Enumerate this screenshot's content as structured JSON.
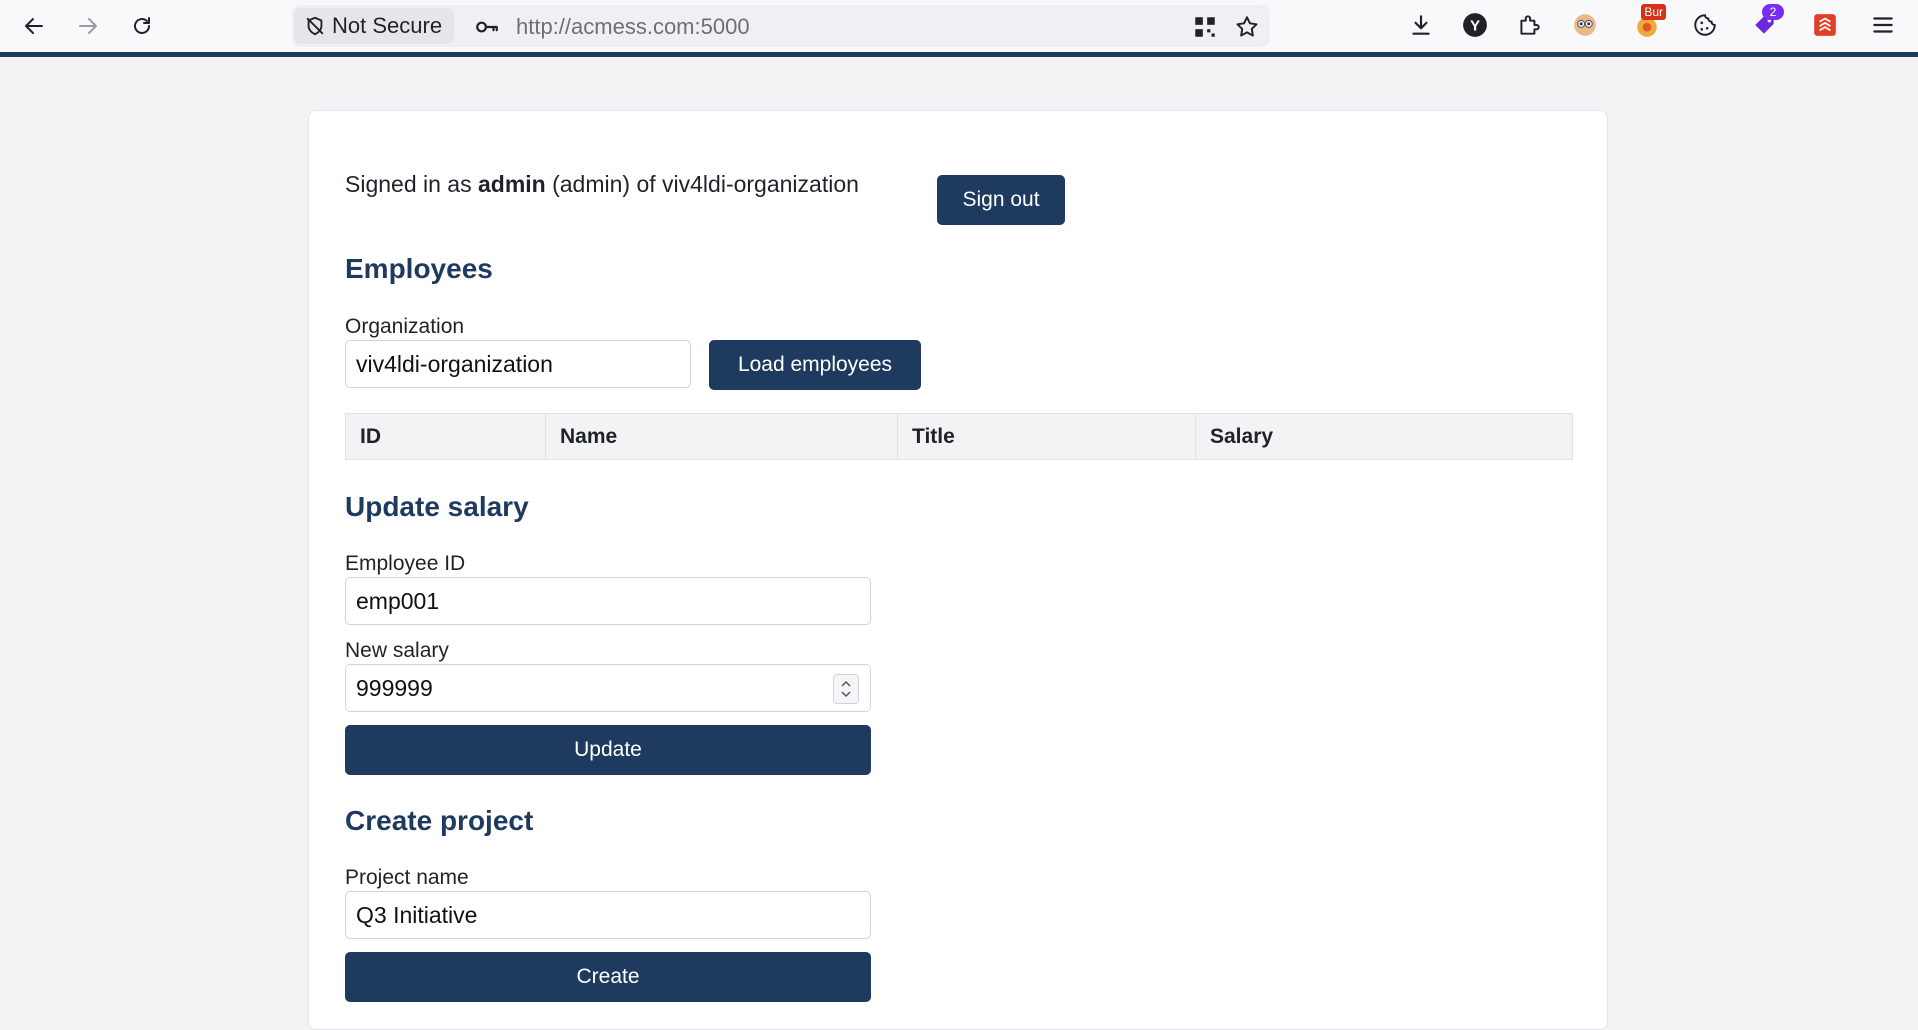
{
  "browser": {
    "security_label": "Not Secure",
    "url_host": "http://acmess.com",
    "url_port": ":5000",
    "extensions": [
      {
        "name": "download-icon"
      },
      {
        "name": "y-extension-icon",
        "label": "Y"
      },
      {
        "name": "extensions-puzzle-icon"
      },
      {
        "name": "owl-extension-icon"
      },
      {
        "name": "burp-extension-icon",
        "badge": "Bur"
      },
      {
        "name": "cookie-icon"
      },
      {
        "name": "tag-extension-icon",
        "badge": "2"
      },
      {
        "name": "red-extension-icon"
      },
      {
        "name": "menu-icon"
      }
    ]
  },
  "page": {
    "signed_prefix": "Signed in as",
    "signed_user": "admin",
    "signed_suffix": "(admin) of viv4ldi-organization",
    "sign_out_label": "Sign out",
    "employees": {
      "heading": "Employees",
      "org_label": "Organization",
      "org_value": "viv4ldi-organization",
      "load_label": "Load employees",
      "columns": [
        "ID",
        "Name",
        "Title",
        "Salary"
      ]
    },
    "update_salary": {
      "heading": "Update salary",
      "employee_id_label": "Employee ID",
      "employee_id_value": "emp001",
      "new_salary_label": "New salary",
      "new_salary_value": "999999",
      "update_label": "Update"
    },
    "create_project": {
      "heading": "Create project",
      "project_name_label": "Project name",
      "project_name_value": "Q3 Initiative",
      "create_label": "Create"
    }
  },
  "colors": {
    "primary": "#1f3a5f",
    "page_bg": "#f1f3f5"
  }
}
